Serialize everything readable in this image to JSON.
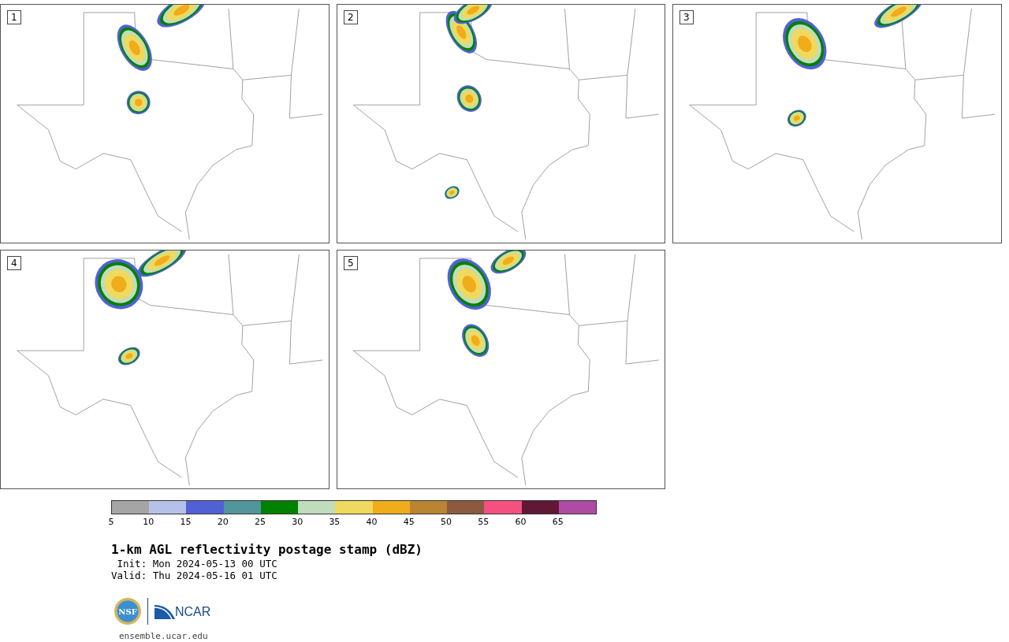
{
  "panels": [
    {
      "label": "1"
    },
    {
      "label": "2"
    },
    {
      "label": "3"
    },
    {
      "label": "4"
    },
    {
      "label": "5"
    }
  ],
  "colorbar": {
    "segments": [
      {
        "color": "#a5a5a5"
      },
      {
        "color": "#b6c1ea"
      },
      {
        "color": "#5260d6"
      },
      {
        "color": "#50969a"
      },
      {
        "color": "#008100"
      },
      {
        "color": "#bfdcbd"
      },
      {
        "color": "#efd95e"
      },
      {
        "color": "#f0ac1b"
      },
      {
        "color": "#ba8433"
      },
      {
        "color": "#8b5a40"
      },
      {
        "color": "#f55180"
      },
      {
        "color": "#611736"
      },
      {
        "color": "#ae4ba3"
      }
    ],
    "ticks": [
      "5",
      "10",
      "15",
      "20",
      "25",
      "30",
      "35",
      "40",
      "45",
      "50",
      "55",
      "60",
      "65"
    ]
  },
  "title": "1-km AGL reflectivity postage stamp (dBZ)",
  "init": " Init: Mon 2024-05-13 00 UTC",
  "valid": "Valid: Thu 2024-05-16 01 UTC",
  "logos": {
    "nsf": "NSF",
    "ncar": "NCAR"
  },
  "url": "ensemble.ucar.edu"
}
